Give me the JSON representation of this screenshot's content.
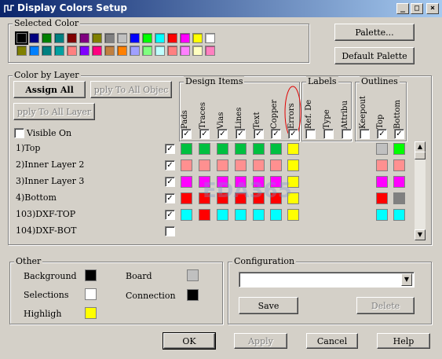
{
  "window": {
    "title": "Display Colors Setup",
    "minimize": "_",
    "maximize": "□",
    "close": "×"
  },
  "selected_color": {
    "label": "Selected Color",
    "palette_row1": [
      "#000000",
      "#000080",
      "#008000",
      "#008080",
      "#800000",
      "#800080",
      "#808000",
      "#808080",
      "#c0c0c0",
      "#0000ff",
      "#00ff00",
      "#00ffff",
      "#ff0000",
      "#ff00ff",
      "#ffff00",
      "#ffffff"
    ],
    "palette_row2": [
      "#808000",
      "#0080ff",
      "#008080",
      "#00a0a0",
      "#ff8080",
      "#8000ff",
      "#ff0080",
      "#c08040",
      "#ff8000",
      "#a0a0ff",
      "#80ff80",
      "#c0ffff",
      "#ff8080",
      "#ff80ff",
      "#ffffc0",
      "#ff80c0"
    ]
  },
  "buttons": {
    "palette": "Palette...",
    "default_palette": "Default Palette",
    "assign_all": "Assign All",
    "apply_to_all_objects": "pply To All Objec",
    "apply_to_all_layers": "pply To All Layer",
    "save": "Save",
    "delete": "Delete",
    "ok": "OK",
    "apply": "Apply",
    "cancel": "Cancel",
    "help": "Help"
  },
  "color_by_layer": {
    "label": "Color by Layer",
    "visible_on": "Visible On",
    "design_items_label": "Design Items",
    "labels_label": "Labels",
    "outlines_label": "Outlines",
    "design_items": [
      "Pads",
      "Traces",
      "Vias",
      "Lines",
      "Text",
      "Copper",
      "Errors"
    ],
    "label_items": [
      "Ref. De",
      "Type",
      "Attribu"
    ],
    "outline_items": [
      "Keepout",
      "Top",
      "Bottom"
    ],
    "visible_checks": [
      true,
      true,
      true,
      true,
      true,
      true,
      true,
      false,
      false,
      false,
      false,
      true,
      true
    ],
    "layers": [
      {
        "name": "1)Top",
        "visible": true,
        "design": [
          "#00c040",
          "#00c040",
          "#00c040",
          "#00c040",
          "#00c040",
          "#00c040",
          "#ffff00"
        ],
        "outlines": [
          "#c0c0c0",
          "#00ff00"
        ]
      },
      {
        "name": "2)Inner Layer 2",
        "visible": true,
        "design": [
          "#ff9090",
          "#ff9090",
          "#ff9090",
          "#ff9090",
          "#ff9090",
          "#ff9090",
          "#ffff00"
        ],
        "outlines": [
          "#ff9090",
          "#ff9090"
        ]
      },
      {
        "name": "3)Inner Layer 3",
        "visible": true,
        "design": [
          "#ff00ff",
          "#ff00ff",
          "#ff00ff",
          "#ff00ff",
          "#ff00ff",
          "#ff00ff",
          "#ffff00"
        ],
        "outlines": [
          "#ff00ff",
          "#ff00ff"
        ]
      },
      {
        "name": "4)Bottom",
        "visible": true,
        "design": [
          "#ff0000",
          "#ff0000",
          "#ff0000",
          "#ff0000",
          "#ff0000",
          "#ff0000",
          "#ffff00"
        ],
        "outlines": [
          "#ff0000",
          "#808080"
        ]
      },
      {
        "name": "103)DXF-TOP",
        "visible": true,
        "design": [
          "#00ffff",
          "#ff0000",
          "#00ffff",
          "#00ffff",
          "#00ffff",
          "#00ffff",
          "#ffff00"
        ],
        "outlines": [
          "#00ffff",
          "#00ffff"
        ]
      },
      {
        "name": "104)DXF-BOT",
        "visible": false,
        "design": [],
        "outlines": []
      }
    ]
  },
  "other": {
    "label": "Other",
    "items": [
      {
        "name": "Background",
        "color": "#000000"
      },
      {
        "name": "Selections",
        "color": "#ffffff"
      },
      {
        "name": "Highligh",
        "color": "#ffff00"
      },
      {
        "name": "Board",
        "color": "#c0c0c0"
      },
      {
        "name": "Connection",
        "color": "#000000"
      }
    ]
  },
  "configuration": {
    "label": "Configuration",
    "value": ""
  },
  "watermark": "EDA365"
}
